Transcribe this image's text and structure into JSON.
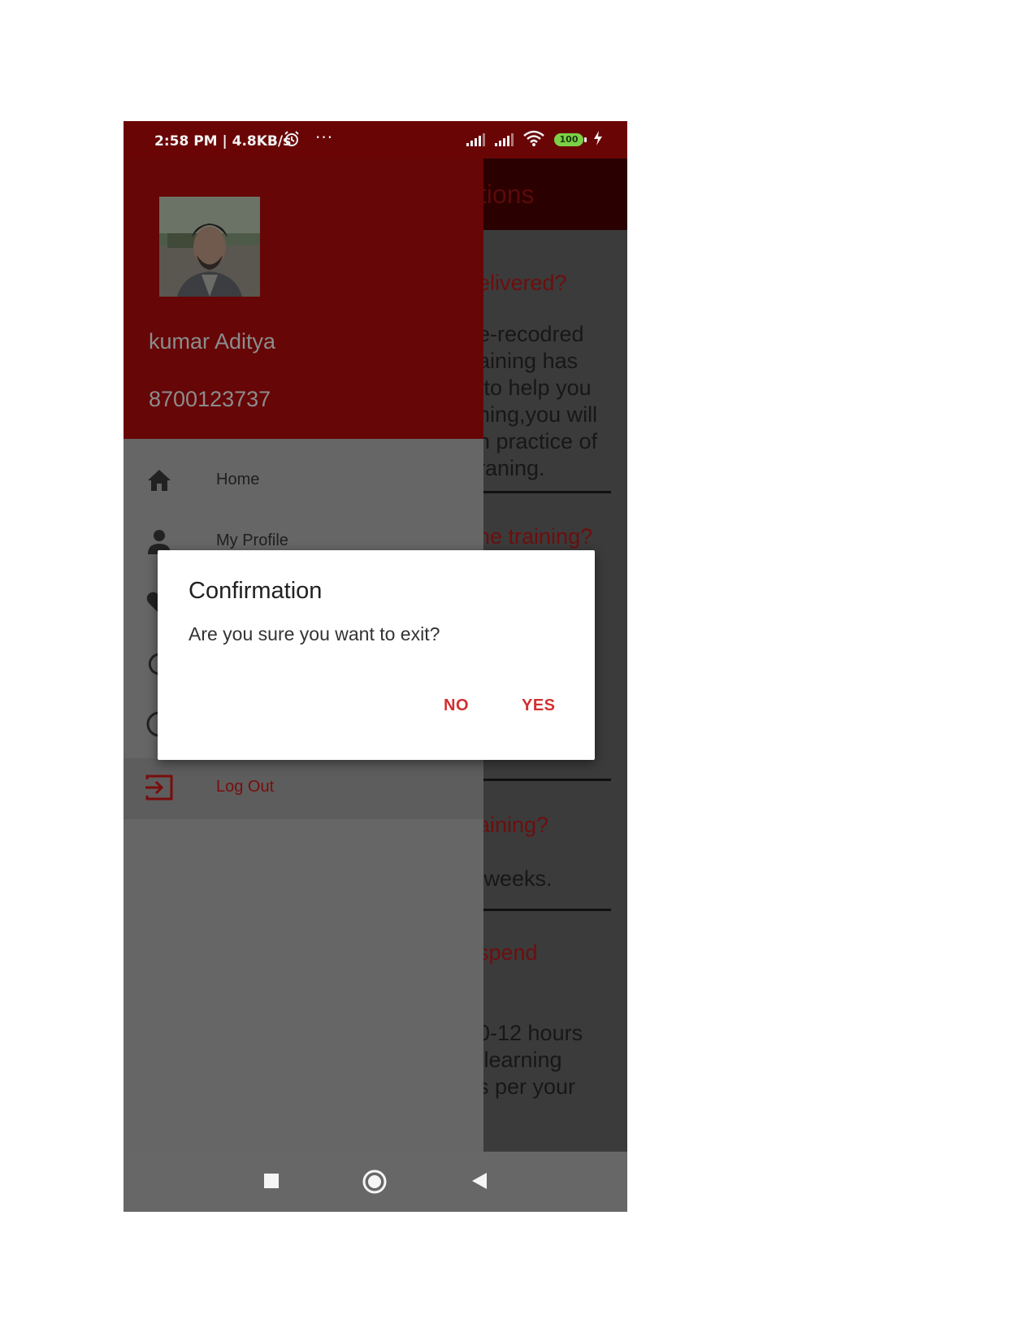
{
  "status_bar": {
    "time": "2:58 PM | 4.8KB/s",
    "battery": "100",
    "icons": [
      "alarm-icon",
      "more-dots-icon",
      "signal-icon",
      "signal-icon",
      "wifi-icon",
      "battery-icon",
      "charging-icon"
    ]
  },
  "background_page": {
    "title_fragment": "tions",
    "items": [
      {
        "question": "elivered?",
        "answer": "e-recodred\naining has\n to help you\nning,you will\nn practice of\nraning."
      },
      {
        "question": "he training?",
        "answer": ""
      },
      {
        "question": "aining?",
        "answer": " weeks."
      },
      {
        "question": " spend",
        "answer": "0-12 hours\n learning\ns per your"
      }
    ]
  },
  "drawer": {
    "user_name": "kumar Aditya",
    "user_phone": "8700123737",
    "menu": [
      {
        "label": "Home",
        "icon": "home-icon"
      },
      {
        "label": "My Profile",
        "icon": "person-icon"
      },
      {
        "label": "",
        "icon": "heart-icon"
      },
      {
        "label": "",
        "icon": "refresh-icon"
      },
      {
        "label": "",
        "icon": "clock-icon"
      },
      {
        "label": "Log Out",
        "icon": "logout-icon"
      }
    ]
  },
  "dialog": {
    "title": "Confirmation",
    "message": "Are you sure you want to exit?",
    "no_label": "NO",
    "yes_label": "YES"
  },
  "nav_bar": {
    "icons": [
      "recents-square-icon",
      "home-circle-icon",
      "back-triangle-icon"
    ]
  },
  "colors": {
    "primary": "#6a0506",
    "accent": "#d32f2f",
    "drawer_bg": "#666666"
  }
}
